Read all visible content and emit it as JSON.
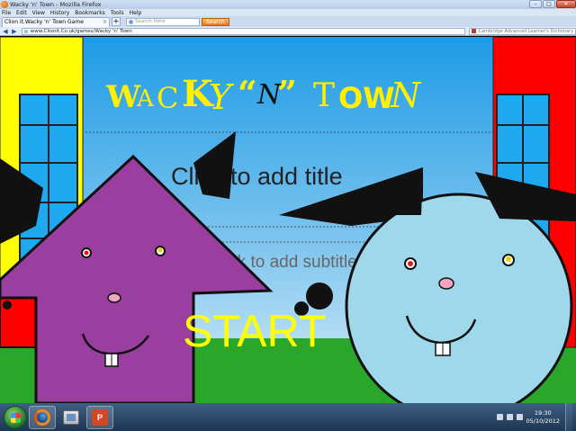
{
  "window": {
    "title": "Wacky 'n' Town - Mozilla Firefox",
    "controls": [
      "–",
      "□",
      "✕"
    ]
  },
  "menu": [
    "File",
    "Edit",
    "View",
    "History",
    "Bookmarks",
    "Tools",
    "Help"
  ],
  "tab": {
    "label": "Clion it.Wacky 'n' Town Game",
    "close": "×",
    "new_tab": "+"
  },
  "toolbar_search": {
    "placeholder": "Search Here",
    "button": "Search"
  },
  "nav": {
    "back": "◀",
    "forward": "▶",
    "url": "www.Clionit.Co.uk/games/Wacky 'n' Town",
    "dictionary": "Cambridge Advanced Learner's Dictionary"
  },
  "slide": {
    "title_letters": [
      "W",
      "A",
      "C",
      "K",
      "Y",
      "“",
      "N",
      "”",
      " ",
      "T",
      "OW",
      "N"
    ],
    "placeholder_title": "Click to add title",
    "placeholder_subtitle": "Click to add subtitle",
    "start_label": "START"
  },
  "taskbar": {
    "pinned": [
      "firefox-icon",
      "explorer-icon",
      "powerpoint-icon"
    ],
    "ppt_label": "P",
    "time": "19:30",
    "date": "05/10/2012"
  },
  "colors": {
    "sky_top": "#1e9be6",
    "sky_bottom": "#cfe8f6",
    "grass": "#2aa62a",
    "building_left": "#ffff00",
    "building_right": "#ff0000",
    "window_blue": "#1ea8f0",
    "purple_cat": "#9a3fa0",
    "blue_cat": "#9fd8ea",
    "start_text": "#ffff00"
  }
}
